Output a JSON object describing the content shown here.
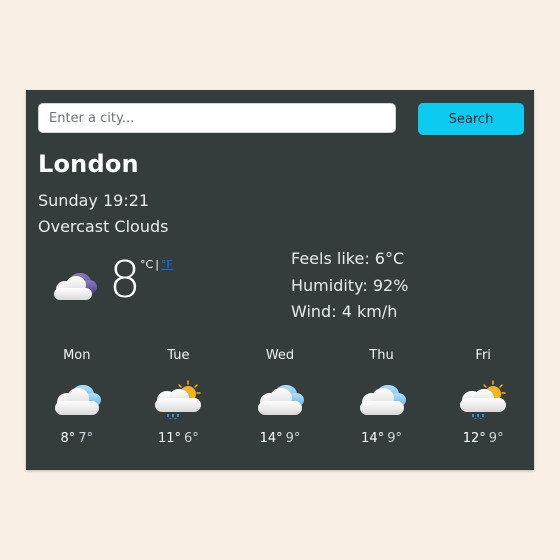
{
  "search": {
    "placeholder": "Enter a city...",
    "value": "",
    "button_label": "Search"
  },
  "current": {
    "city": "London",
    "datetime": "Sunday 19:21",
    "description": "Overcast Clouds",
    "icon": "overcast-clouds-icon",
    "temperature": "8",
    "unit_celsius": "°C",
    "unit_separator": "|",
    "unit_fahrenheit": "°F",
    "feels_like": "Feels like: 6°C",
    "humidity": "Humidity: 92%",
    "wind": "Wind: 4 km/h"
  },
  "forecast": [
    {
      "day": "Mon",
      "icon": "cloudy-icon",
      "max": "8°",
      "min": "7°"
    },
    {
      "day": "Tue",
      "icon": "rain-sun-cloud-icon",
      "max": "11°",
      "min": "6°"
    },
    {
      "day": "Wed",
      "icon": "cloudy-icon",
      "max": "14°",
      "min": "9°"
    },
    {
      "day": "Thu",
      "icon": "cloudy-icon",
      "max": "14°",
      "min": "9°"
    },
    {
      "day": "Fri",
      "icon": "rain-sun-cloud-icon",
      "max": "12°",
      "min": "9°"
    }
  ],
  "colors": {
    "page_background": "#f8efe5",
    "card_background": "#343d3c",
    "accent": "#0dcaf0",
    "link": "#0d6efd"
  }
}
